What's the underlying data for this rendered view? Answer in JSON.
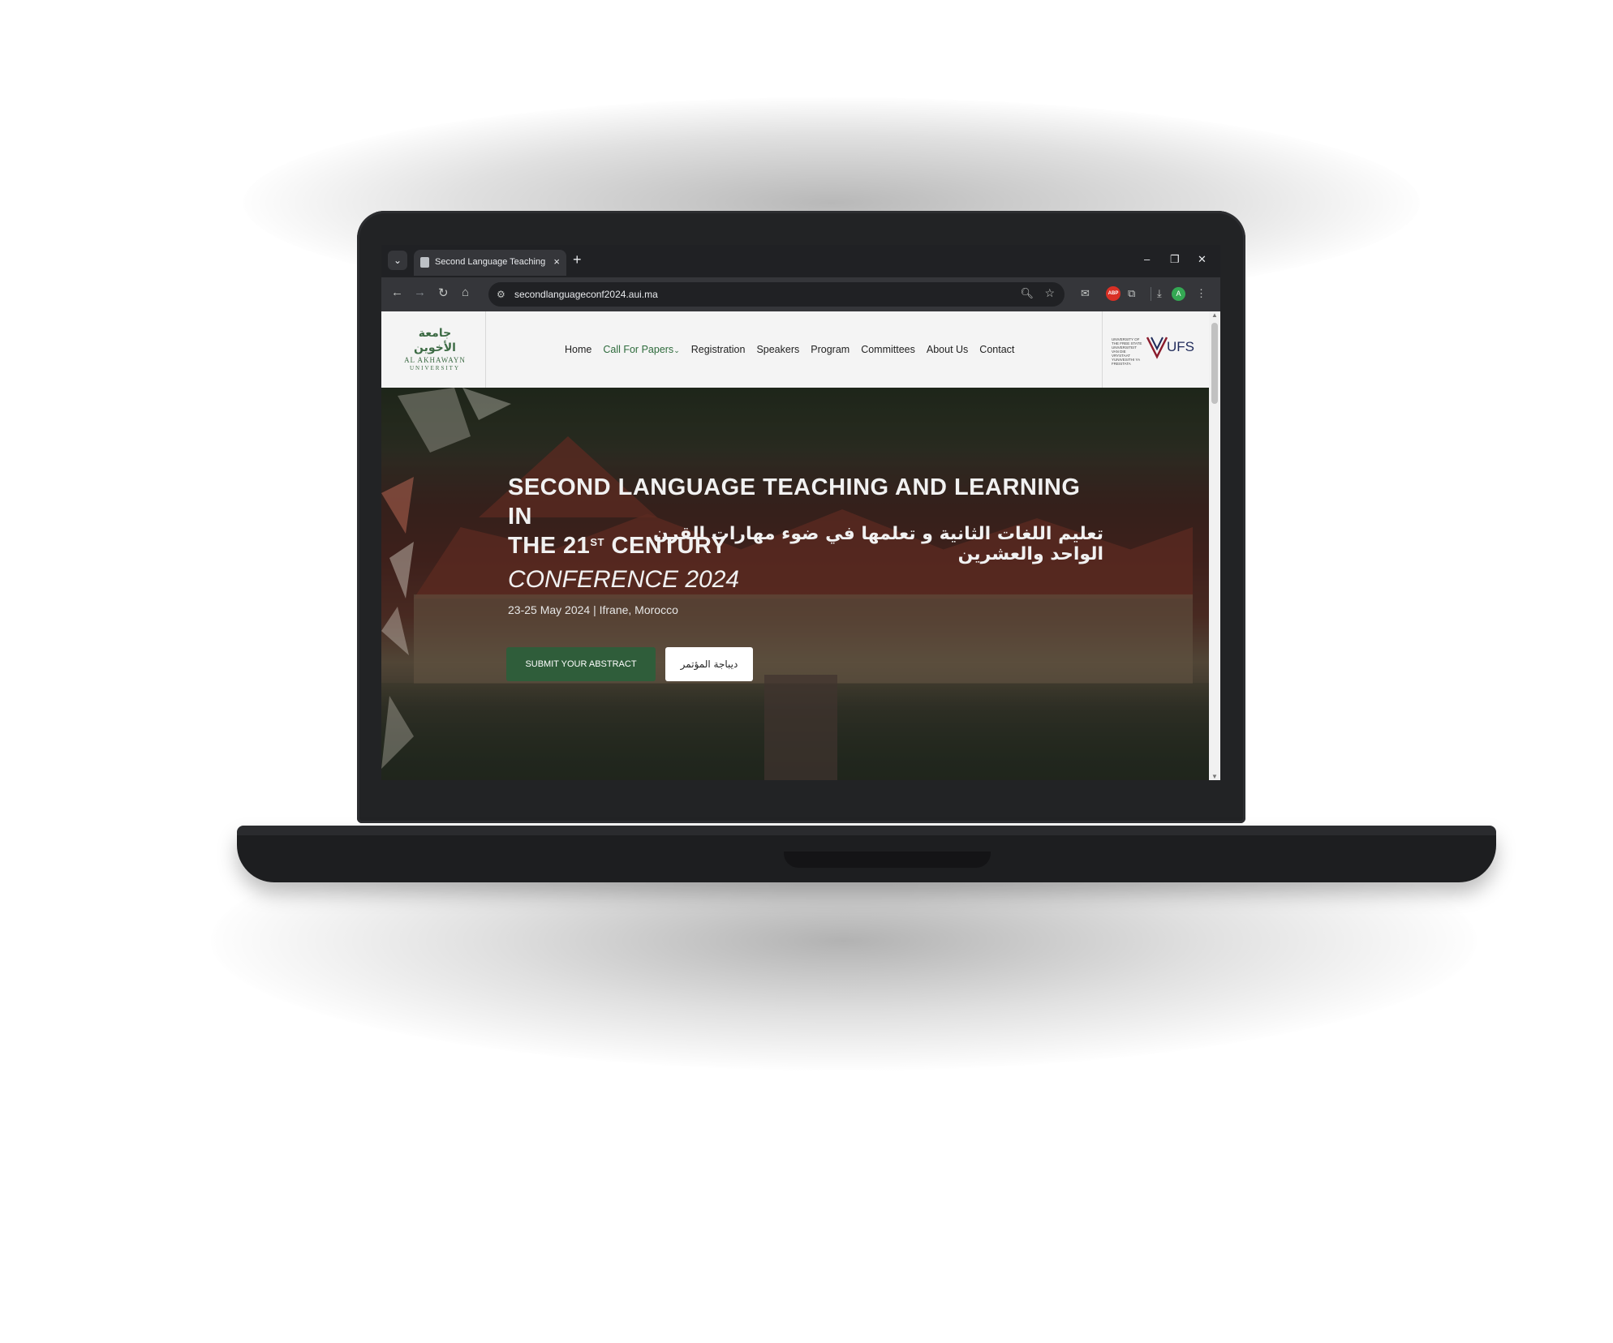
{
  "browser": {
    "tab_title": "Second Language Teaching and Learning",
    "new_tab_symbol": "+",
    "close_symbol": "×",
    "url": "secondlanguageconf2024.aui.ma",
    "profile_initial": "A",
    "adblock_label": "ABP",
    "window_controls": {
      "minimize": "–",
      "restore": "❐",
      "close": "✕"
    },
    "icons": [
      "back-icon",
      "forward-icon",
      "reload-icon",
      "home-icon",
      "site-info-icon",
      "zoom-icon",
      "bookmark-star-icon",
      "mail-icon",
      "extensions-icon",
      "download-icon",
      "menu-icon"
    ]
  },
  "header": {
    "logo_left": {
      "arabic": "جامعة الأخوين",
      "english": "AL AKHAWAYN",
      "english_sub": "UNIVERSITY"
    },
    "nav": [
      "Home",
      "Call For Papers",
      "Registration",
      "Speakers",
      "Program",
      "Committees",
      "About Us",
      "Contact"
    ],
    "nav_active_index": 1,
    "logo_right": {
      "small_text": "UNIVERSITY OF THE FREE STATE UNIVERSITEIT VAN DIE VRYSTAAT YUNIVESITHI YA FREISTATA",
      "mark": "UFS"
    }
  },
  "hero": {
    "title_line1": "SECOND LANGUAGE TEACHING AND LEARNING IN",
    "title_line2_prefix": "THE 21",
    "title_sup": "ST",
    "title_line2_suffix": " CENTURY",
    "arabic_title": "تعليم اللغات الثانية و تعلمها في ضوء مهارات القرن الواحد والعشرين",
    "conference": "CONFERENCE 2024",
    "date_location": "23-25 May 2024 | Ifrane, Morocco",
    "btn_submit": "SUBMIT YOUR ABSTRACT",
    "btn_arabic": "ديباجة المؤتمر"
  },
  "colors": {
    "accent_green": "#2f5d3a",
    "nav_active": "#2e6b3c",
    "ufs_navy": "#1f2a5a",
    "browser_dark": "#202124"
  }
}
